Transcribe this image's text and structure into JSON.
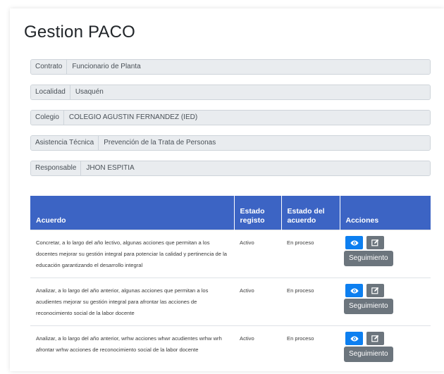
{
  "page": {
    "title": "Gestion PACO"
  },
  "info": [
    {
      "label": "Contrato",
      "value": "Funcionario de Planta"
    },
    {
      "label": "Localidad",
      "value": "Usaquén"
    },
    {
      "label": "Colegio",
      "value": "COLEGIO AGUSTIN FERNANDEZ (IED)"
    },
    {
      "label": "Asistencia Técnica",
      "value": "Prevención de la Trata de Personas"
    },
    {
      "label": "Responsable",
      "value": "JHON ESPITIA"
    }
  ],
  "table": {
    "headers": {
      "acuerdo": "Acuerdo",
      "estado_registro_1": "Estado",
      "estado_registro_2": "registo",
      "estado_acuerdo_1": "Estado del",
      "estado_acuerdo_2": "acuerdo",
      "acciones": "Acciones"
    },
    "rows": [
      {
        "acuerdo": "Concretar, a lo largo del año lectivo, algunas acciones que permitan a los docentes mejorar su gestión integral para potenciar la calidad y pertinencia de la educación garantizando el desarrollo integral",
        "estado_registro": "Activo",
        "estado_acuerdo": "En proceso",
        "seguimiento_label": "Seguimiento"
      },
      {
        "acuerdo": "Analizar, a lo largo del año anterior, algunas acciones que permitan a los acudientes mejorar su gestión integral para afrontar las acciones de reconocimiento social de la labor docente",
        "estado_registro": "Activo",
        "estado_acuerdo": "En proceso",
        "seguimiento_label": "Seguimiento"
      },
      {
        "acuerdo": "Analizar, a lo largo del año anterior, wrhw acciones whwr acudientes wrhw wrh afrontar wrhw acciones de reconocimiento social de la labor docente",
        "estado_registro": "Activo",
        "estado_acuerdo": "En proceso",
        "seguimiento_label": "Seguimiento"
      }
    ]
  },
  "icons": {
    "view": "eye-icon",
    "edit": "edit-icon"
  },
  "colors": {
    "header_bg": "#3c64c4",
    "view_button": "#0d7ff0",
    "secondary_button": "#6c757d",
    "input_bg": "#e9ecef"
  }
}
